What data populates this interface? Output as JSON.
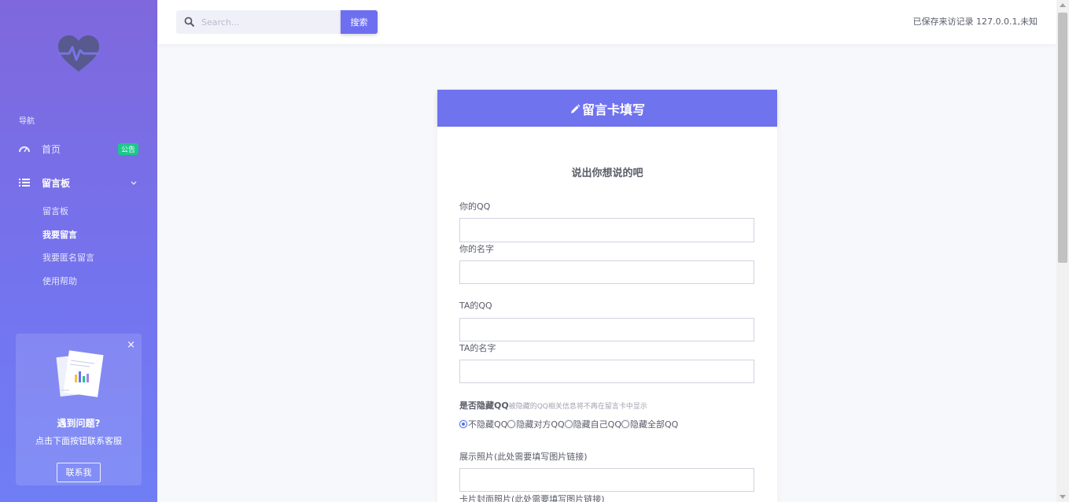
{
  "sidebar": {
    "nav_heading": "导航",
    "items": [
      {
        "label": "首页",
        "badge": "公告"
      },
      {
        "label": "留言板"
      }
    ],
    "sub_items": [
      "留言板",
      "我要留言",
      "我要匿名留言",
      "使用帮助"
    ],
    "promo": {
      "close": "×",
      "title": "遇到问题?",
      "text": "点击下面按钮联系客服",
      "button": "联系我"
    }
  },
  "topbar": {
    "search_placeholder": "Search...",
    "search_button": "搜索",
    "visitor_text": "已保存来访记录 127.0.0.1,未知"
  },
  "card": {
    "title": "留言卡填写",
    "subtitle": "说出你想说的吧",
    "fields": {
      "your_qq": "你的QQ",
      "your_name": "你的名字",
      "ta_qq": "TA的QQ",
      "ta_name": "TA的名字",
      "hide_qq": "是否隐藏QQ",
      "hide_qq_hint": "被隐藏的QQ相关信息将不再在留言卡中显示",
      "photo": "展示照片(此处需要填写图片链接)",
      "cover": "卡片封面照片(此处需要填写图片链接)"
    },
    "radio_options": [
      "不隐藏QQ",
      "隐藏对方QQ",
      "隐藏自己QQ",
      "隐藏全部QQ"
    ],
    "radio_selected": 0
  },
  "colors": {
    "accent": "#6e6ff0",
    "badge": "#1cc88a",
    "sidebar_top": "#7f68dc",
    "sidebar_bottom": "#6f7ef5"
  }
}
